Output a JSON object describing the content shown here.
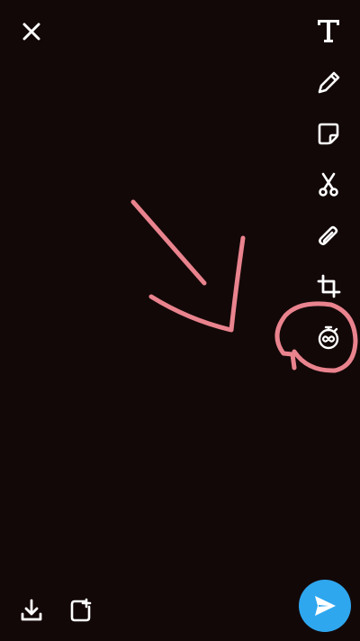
{
  "toolbar": {
    "close_icon": "close-icon",
    "tools": [
      "text-tool-icon",
      "pencil-icon",
      "sticker-icon",
      "scissors-icon",
      "paperclip-icon",
      "crop-icon",
      "timer-infinity-icon"
    ]
  },
  "bottom_bar": {
    "download_icon": "download-icon",
    "add_story_icon": "add-story-icon",
    "send_icon": "send-icon"
  },
  "colors": {
    "background": "#130808",
    "annotation": "#e9838e",
    "send_button": "#2ea7ef",
    "icon": "#ffffff"
  }
}
